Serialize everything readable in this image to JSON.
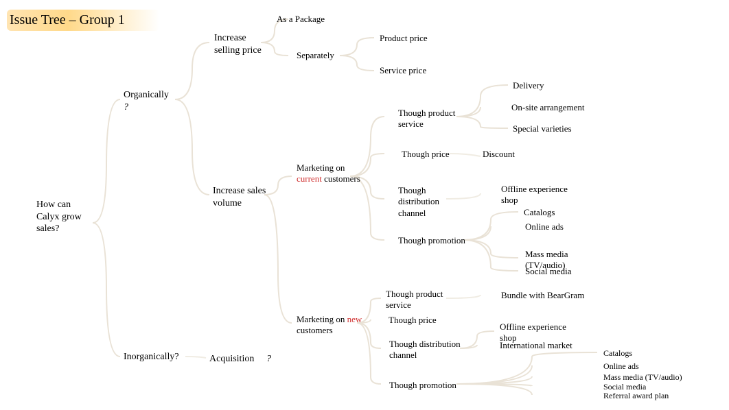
{
  "title": "Issue Tree – Group 1",
  "root": "How can Calyx grow sales?",
  "level1": {
    "organically": "Organically",
    "organically_q": "?",
    "inorganically": "Inorganically?",
    "acquisition": "Acquisition",
    "acquisition_q": "?"
  },
  "level2": {
    "increase_price": "Increase selling price",
    "increase_volume": "Increase sales volume"
  },
  "price_branch": {
    "as_package": "As a Package",
    "separately": "Separately",
    "product_price": "Product price",
    "service_price": "Service price"
  },
  "volume_branch": {
    "marketing_current_pre": "Marketing on",
    "current_word": "current",
    "marketing_current_post": "customers",
    "marketing_new_pre": "Marketing on",
    "new_word": "new",
    "marketing_new_post": "customers"
  },
  "tactic": {
    "product_service": "Though product service",
    "price": "Though price",
    "distribution": "Though distribution channel",
    "promotion": "Though promotion"
  },
  "detail_current": {
    "delivery": "Delivery",
    "onsite": "On-site arrangement",
    "special": "Special varieties",
    "discount": "Discount",
    "offline_shop": "Offline experience shop",
    "catalogs": "Catalogs",
    "online_ads": "Online ads",
    "mass_media": "Mass media (TV/audio)",
    "social_media": "Social media"
  },
  "detail_new": {
    "bundle": "Bundle with BearGram",
    "offline_shop": "Offline experience shop",
    "international": "International market",
    "catalogs": "Catalogs",
    "online_ads": "Online ads",
    "mass_media": "Mass media (TV/audio)",
    "social_media": "Social media",
    "referral": "Referral award plan"
  }
}
